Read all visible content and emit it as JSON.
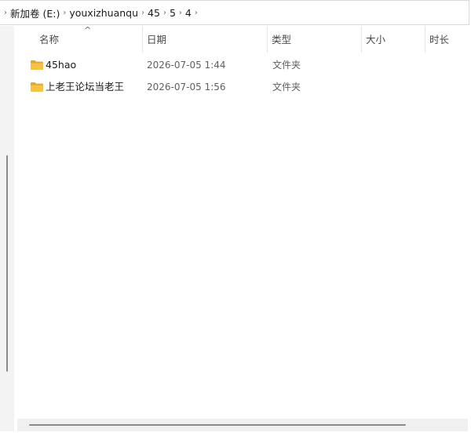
{
  "breadcrumb": {
    "items": [
      "新加卷 (E:)",
      "youxizhuanqu",
      "45",
      "5",
      "4"
    ],
    "separator": "›"
  },
  "columns": {
    "name": "名称",
    "date": "日期",
    "type": "类型",
    "size": "大小",
    "duration": "时长",
    "sort_indicator": "^"
  },
  "files": [
    {
      "name": "45hao",
      "date": "2026-07-05 1:44",
      "type": "文件夹",
      "icon": "folder-icon"
    },
    {
      "name": "上老王论坛当老王",
      "date": "2026-07-05 1:56",
      "type": "文件夹",
      "icon": "folder-icon"
    }
  ],
  "colors": {
    "folder": "#f5c243",
    "folder_dark": "#e0a82e",
    "header_text": "#4a4a4a",
    "secondary_text": "#5f5f5f"
  }
}
